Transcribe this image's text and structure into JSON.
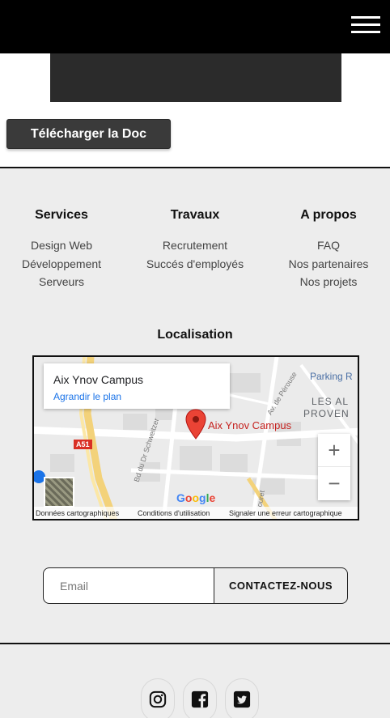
{
  "colors": {
    "topbar": "#000000",
    "background": "#ededed",
    "button": "#3a3a3a",
    "pin": "#d93025",
    "link": "#1a73e8"
  },
  "header": {
    "menu_icon": "hamburger-menu-icon"
  },
  "hero": {
    "download_label": "Télécharger la Doc"
  },
  "footer": {
    "columns": [
      {
        "title": "Services",
        "links": [
          "Design Web",
          "Développement",
          "Serveurs"
        ]
      },
      {
        "title": "Travaux",
        "links": [
          "Recrutement",
          "Succés d'employés"
        ]
      },
      {
        "title": "A propos",
        "links": [
          "FAQ",
          "Nos partenaires",
          "Nos projets"
        ]
      }
    ],
    "location": {
      "title": "Localisation",
      "map": {
        "place_name": "Aix Ynov Campus",
        "enlarge_label": "Agrandir le plan",
        "pin_label": "Aix Ynov Campus",
        "poi_parking": "Parking R",
        "poi_area_1": "LES AL",
        "poi_area_2": "PROVEN",
        "street_1": "Av. de Pérouse",
        "street_2": "Bd du Dr Schweitzer",
        "street_3": "ouret",
        "road_badge": "A51",
        "zoom_in": "+",
        "zoom_out": "−",
        "attribution": [
          "Données cartographiques",
          "Conditions d'utilisation",
          "Signaler une erreur cartographique"
        ]
      }
    },
    "contact": {
      "email_placeholder": "Email",
      "button_label": "CONTACTEZ-NOUS"
    },
    "socials": [
      "instagram-icon",
      "facebook-icon",
      "twitter-icon"
    ]
  }
}
